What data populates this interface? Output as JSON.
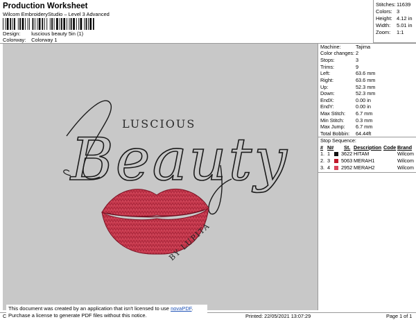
{
  "header": {
    "title": "Production Worksheet",
    "subtitle": "Wilcom EmbroideryStudio – Level 3 Advanced",
    "design_label": "Design:",
    "design_value": "luscious beauty 5in (1)",
    "colorway_label": "Colorway:",
    "colorway_value": "Colorway 1"
  },
  "stats": [
    {
      "k": "Stitches:",
      "v": "11639"
    },
    {
      "k": "Colors:",
      "v": "3"
    },
    {
      "k": "Height:",
      "v": "4.12 in"
    },
    {
      "k": "Width:",
      "v": "5.01 in"
    },
    {
      "k": "Zoom:",
      "v": "1:1"
    }
  ],
  "design_art": {
    "luscious": "LUSCIOUS",
    "beauty": "Beauty",
    "by_lupita": "BY LUPITA"
  },
  "machine_info": [
    {
      "k": "Machine:",
      "v": "Tajima"
    },
    {
      "k": "Color changes:",
      "v": "2"
    },
    {
      "k": "Stops:",
      "v": "3"
    },
    {
      "k": "Trims:",
      "v": "9"
    },
    {
      "k": "Left:",
      "v": "63.6 mm"
    },
    {
      "k": "Right:",
      "v": "63.6 mm"
    },
    {
      "k": "Up:",
      "v": "52.3 mm"
    },
    {
      "k": "Down:",
      "v": "52.3 mm"
    },
    {
      "k": "EndX:",
      "v": "0.00 in"
    },
    {
      "k": "EndY:",
      "v": "0.00 in"
    },
    {
      "k": "Max Stitch:",
      "v": "6.7 mm"
    },
    {
      "k": "Min Stitch:",
      "v": "0.3 mm"
    },
    {
      "k": "Max Jump:",
      "v": "6.7 mm"
    },
    {
      "k": "Total Bobbin:",
      "v": "64.44ft"
    }
  ],
  "stop_sequence": {
    "label": "Stop Sequence:",
    "headers": [
      "#",
      "N#",
      "St.",
      "Description",
      "Code",
      "Brand"
    ],
    "rows": [
      {
        "num": "1.",
        "n": "1",
        "color": "#111111",
        "st": "3622",
        "desc": "HITAM",
        "code": "",
        "brand": "Wilcom"
      },
      {
        "num": "2.",
        "n": "3",
        "color": "#c0182b",
        "st": "5063",
        "desc": "MERAH1",
        "code": "",
        "brand": "Wilcom"
      },
      {
        "num": "3.",
        "n": "4",
        "color": "#d9455a",
        "st": "2952",
        "desc": "MERAH2",
        "code": "",
        "brand": "Wilcom"
      }
    ]
  },
  "footer": {
    "cr": "Cr",
    "printed": "Printed: 22/05/2021 13:07:29",
    "page": "Page 1 of 1"
  },
  "notice": {
    "line1_before": "This document was created by an application that isn't licensed to use ",
    "link": "novaPDF",
    "line1_after": ".",
    "line2": "Purchase a license to generate PDF files without this notice."
  }
}
